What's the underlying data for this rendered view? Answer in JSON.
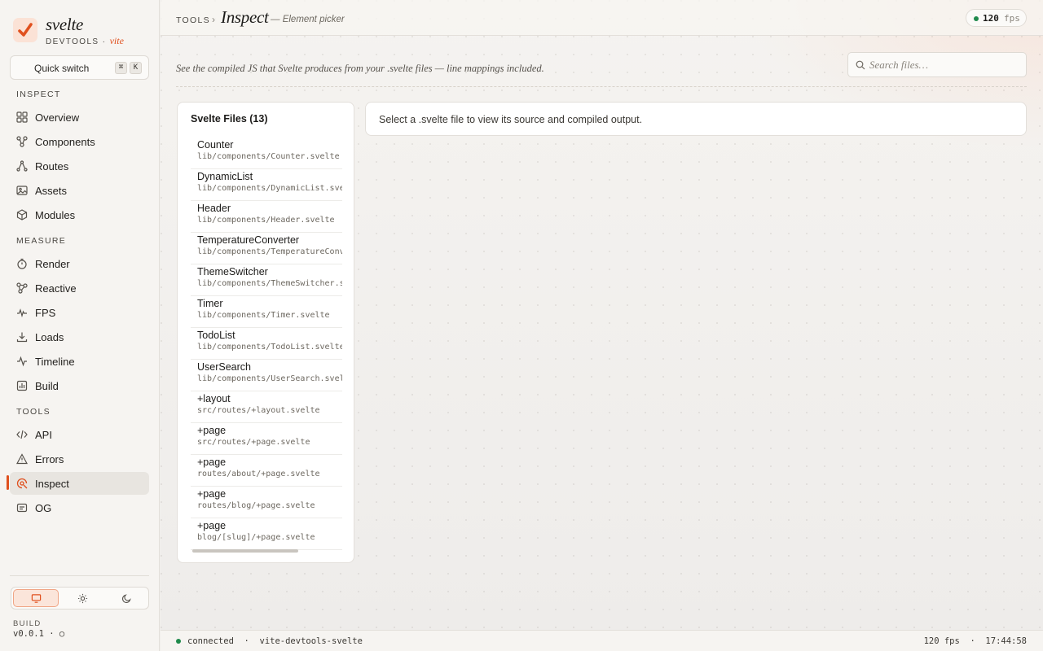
{
  "brand": {
    "name": "svelte",
    "sub": "DEVTOOLS",
    "sep": " · ",
    "vite": "vite"
  },
  "quick_switch": {
    "label": "Quick switch",
    "key1": "⌘",
    "key2": "K"
  },
  "sidebar": {
    "sections": [
      {
        "title": "INSPECT",
        "items": [
          {
            "label": "Overview",
            "icon": "grid-icon"
          },
          {
            "label": "Components",
            "icon": "component-tree-icon"
          },
          {
            "label": "Routes",
            "icon": "routes-icon"
          },
          {
            "label": "Assets",
            "icon": "image-icon"
          },
          {
            "label": "Modules",
            "icon": "cube-icon"
          }
        ]
      },
      {
        "title": "MEASURE",
        "items": [
          {
            "label": "Render",
            "icon": "stopwatch-icon"
          },
          {
            "label": "Reactive",
            "icon": "graph-icon"
          },
          {
            "label": "FPS",
            "icon": "pulse-icon"
          },
          {
            "label": "Loads",
            "icon": "download-icon"
          },
          {
            "label": "Timeline",
            "icon": "activity-icon"
          },
          {
            "label": "Build",
            "icon": "bar-chart-icon"
          }
        ]
      },
      {
        "title": "TOOLS",
        "items": [
          {
            "label": "API",
            "icon": "code-icon"
          },
          {
            "label": "Errors",
            "icon": "warning-icon"
          },
          {
            "label": "Inspect",
            "icon": "inspect-icon",
            "active": true
          },
          {
            "label": "OG",
            "icon": "card-icon"
          }
        ]
      }
    ]
  },
  "theme": {
    "options": [
      "monitor-icon",
      "sun-icon",
      "moon-icon"
    ],
    "selected": "monitor-icon"
  },
  "build": {
    "label": "BUILD",
    "version": "v0.0.1 · ○"
  },
  "header": {
    "crumb": "TOOLS",
    "sep": "›",
    "title": "Inspect",
    "desc": "— Element picker",
    "fps_value": "120",
    "fps_unit": "fps"
  },
  "page": {
    "description": "See the compiled JS that Svelte produces from your .svelte files — line mappings included.",
    "search_placeholder": "Search files…"
  },
  "files": {
    "title": "Svelte Files (13)",
    "items": [
      {
        "name": "Counter",
        "path": "lib/components/Counter.svelte"
      },
      {
        "name": "DynamicList",
        "path": "lib/components/DynamicList.svelte"
      },
      {
        "name": "Header",
        "path": "lib/components/Header.svelte"
      },
      {
        "name": "TemperatureConverter",
        "path": "lib/components/TemperatureConverter.svelte"
      },
      {
        "name": "ThemeSwitcher",
        "path": "lib/components/ThemeSwitcher.svelte"
      },
      {
        "name": "Timer",
        "path": "lib/components/Timer.svelte"
      },
      {
        "name": "TodoList",
        "path": "lib/components/TodoList.svelte"
      },
      {
        "name": "UserSearch",
        "path": "lib/components/UserSearch.svelte"
      },
      {
        "name": "+layout",
        "path": "src/routes/+layout.svelte"
      },
      {
        "name": "+page",
        "path": "src/routes/+page.svelte"
      },
      {
        "name": "+page",
        "path": "routes/about/+page.svelte"
      },
      {
        "name": "+page",
        "path": "routes/blog/+page.svelte"
      },
      {
        "name": "+page",
        "path": "blog/[slug]/+page.svelte"
      }
    ]
  },
  "output": {
    "message": "Select a .svelte file to view its source and compiled output."
  },
  "status": {
    "left": "connected  ·  vite-devtools-svelte",
    "right": "120 fps  ·  17:44:58"
  },
  "colors": {
    "accent": "#e0501e",
    "ok": "#1f8a4c"
  }
}
